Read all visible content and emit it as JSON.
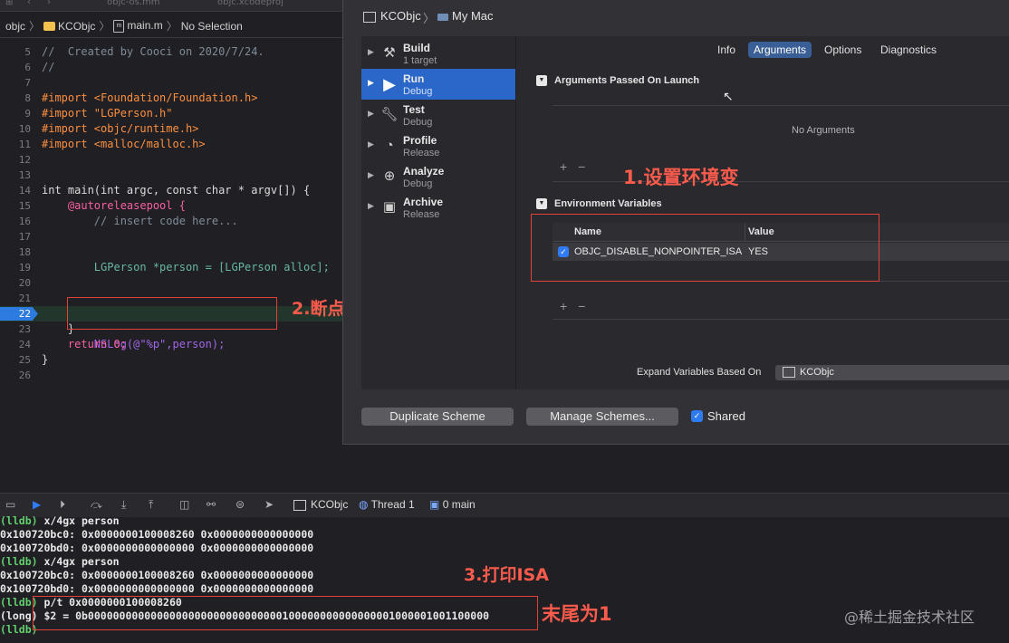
{
  "tabs": [
    "objc-os.mm",
    "objc.xcodeproj"
  ],
  "jump_bar": {
    "project": "objc",
    "target": "KCObjc",
    "file": "main.m",
    "selection": "No Selection"
  },
  "code_lines": [
    {
      "n": "5",
      "text": "//  Created by Cooci on 2020/7/24."
    },
    {
      "n": "6",
      "text": "//"
    },
    {
      "n": "7",
      "text": ""
    },
    {
      "n": "8",
      "text": "#import <Foundation/Foundation.h>"
    },
    {
      "n": "9",
      "text": "#import \"LGPerson.h\""
    },
    {
      "n": "10",
      "text": "#import <objc/runtime.h>"
    },
    {
      "n": "11",
      "text": "#import <malloc/malloc.h>"
    },
    {
      "n": "12",
      "text": ""
    },
    {
      "n": "13",
      "text": ""
    },
    {
      "n": "14",
      "text": "int main(int argc, const char * argv[]) {"
    },
    {
      "n": "15",
      "text": "    @autoreleasepool {"
    },
    {
      "n": "16",
      "text": "        // insert code here..."
    },
    {
      "n": "17",
      "text": ""
    },
    {
      "n": "18",
      "text": ""
    },
    {
      "n": "19",
      "text": "        LGPerson *person = [LGPerson alloc];"
    },
    {
      "n": "20",
      "text": ""
    },
    {
      "n": "21",
      "text": ""
    },
    {
      "n": "22",
      "text": "        NSLog(@\"%p\",person);"
    },
    {
      "n": "23",
      "text": "    }"
    },
    {
      "n": "24",
      "text": "    return 0;"
    },
    {
      "n": "25",
      "text": "}"
    },
    {
      "n": "26",
      "text": ""
    }
  ],
  "annotations": {
    "env": "1.设置环境变",
    "breakpoint": "2.断点",
    "print_isa": "3.打印ISA",
    "ends_with_1": "末尾为1"
  },
  "scheme": {
    "scheme_name": "KCObjc",
    "destination": "My Mac",
    "actions": [
      {
        "name": "Build",
        "sub": "1 target",
        "icon": "hammer-icon",
        "selected": false
      },
      {
        "name": "Run",
        "sub": "Debug",
        "icon": "play-icon",
        "selected": true
      },
      {
        "name": "Test",
        "sub": "Debug",
        "icon": "wrench-icon",
        "selected": false
      },
      {
        "name": "Profile",
        "sub": "Release",
        "icon": "gauge-icon",
        "selected": false
      },
      {
        "name": "Analyze",
        "sub": "Debug",
        "icon": "analyze-icon",
        "selected": false
      },
      {
        "name": "Archive",
        "sub": "Release",
        "icon": "archive-icon",
        "selected": false
      }
    ],
    "segments": [
      "Info",
      "Arguments",
      "Options",
      "Diagnostics"
    ],
    "selected_segment": "Arguments",
    "args_title": "Arguments Passed On Launch",
    "no_args": "No Arguments",
    "env_title": "Environment Variables",
    "env_columns": [
      "Name",
      "Value"
    ],
    "env_rows": [
      {
        "name": "OBJC_DISABLE_NONPOINTER_ISA",
        "value": "YES",
        "enabled": true
      }
    ],
    "expand_label": "Expand Variables Based On",
    "expand_value": "KCObjc",
    "duplicate_button": "Duplicate Scheme",
    "manage_button": "Manage Schemes...",
    "shared_label": "Shared",
    "shared_checked": true
  },
  "debug_bar": {
    "target": "KCObjc",
    "thread": "Thread 1",
    "frame": "0 main"
  },
  "console": [
    {
      "prefix": "(lldb)",
      "text": " x/4gx person"
    },
    {
      "prefix": "",
      "text": "0x100720bc0: 0x0000000100008260 0x0000000000000000"
    },
    {
      "prefix": "",
      "text": "0x100720bd0: 0x0000000000000000 0x0000000000000000"
    },
    {
      "prefix": "(lldb)",
      "text": " x/4gx person"
    },
    {
      "prefix": "",
      "text": "0x100720bc0: 0x0000000100008260 0x0000000000000000"
    },
    {
      "prefix": "",
      "text": "0x100720bd0: 0x0000000000000000 0x0000000000000000"
    },
    {
      "prefix": "(lldb)",
      "text": " p/t 0x0000000100008260"
    },
    {
      "prefix": "",
      "text": "(long) $2 = 0b0000000000000000000000000000000100000000000000001000001001100000"
    },
    {
      "prefix": "(lldb)",
      "text": ""
    }
  ],
  "watermark": "@稀土掘金技术社区",
  "colors": {
    "accent": "#2b66c9",
    "annotation": "#e0423a",
    "lldb_prompt": "#63d06e"
  }
}
